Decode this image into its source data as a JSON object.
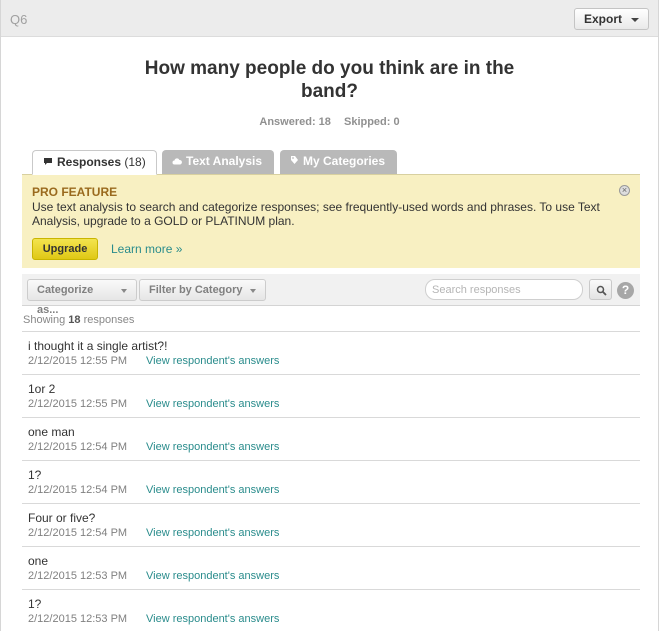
{
  "header": {
    "question_number": "Q6",
    "export_label": "Export"
  },
  "question": {
    "title_line1": "How many people do you think are in the",
    "title_line2": "band?",
    "answered": "Answered: 18",
    "skipped": "Skipped: 0"
  },
  "tabs": [
    {
      "label": "Responses",
      "count": "(18)",
      "icon": "speech-bubble-icon"
    },
    {
      "label": "Text Analysis",
      "icon": "cloud-icon"
    },
    {
      "label": "My Categories",
      "icon": "tag-icon"
    }
  ],
  "pro_feature": {
    "title": "PRO FEATURE",
    "text": "Use text analysis to search and categorize responses; see frequently-used words and phrases. To use Text Analysis, upgrade to a GOLD or PLATINUM plan.",
    "upgrade_label": "Upgrade",
    "learn_more_label": "Learn more »"
  },
  "toolbar": {
    "categorize_label": "Categorize as...",
    "filter_label": "Filter by Category",
    "search_placeholder": "Search responses",
    "help_label": "?"
  },
  "showing": {
    "prefix": "Showing",
    "count": "18",
    "suffix": "responses"
  },
  "responses": [
    {
      "text": "i thought it a single artist?!",
      "date": "2/12/2015 12:55 PM",
      "link": "View respondent's answers"
    },
    {
      "text": "1or 2",
      "date": "2/12/2015 12:55 PM",
      "link": "View respondent's answers"
    },
    {
      "text": "one man",
      "date": "2/12/2015 12:54 PM",
      "link": "View respondent's answers"
    },
    {
      "text": "1?",
      "date": "2/12/2015 12:54 PM",
      "link": "View respondent's answers"
    },
    {
      "text": "Four or five?",
      "date": "2/12/2015 12:54 PM",
      "link": "View respondent's answers"
    },
    {
      "text": "one",
      "date": "2/12/2015 12:53 PM",
      "link": "View respondent's answers"
    },
    {
      "text": "1?",
      "date": "2/12/2015 12:53 PM",
      "link": "View respondent's answers"
    }
  ],
  "colors": {
    "accent_link": "#2a8c8c",
    "pro_background": "#f8f0c2",
    "pro_title": "#9a6a1e",
    "upgrade_button": "#e8d42c"
  }
}
